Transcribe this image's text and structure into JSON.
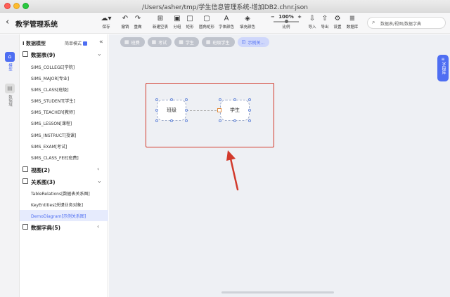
{
  "window": {
    "title": "/Users/asher/tmp/学生信息管理系统-增加DB2.chnr.json"
  },
  "header": {
    "back_glyph": "‹",
    "app_title": "教学管理系统",
    "toolbar": [
      {
        "id": "save",
        "label": "保存",
        "icon": "cloud-save-icon",
        "glyph": "☁▾"
      },
      {
        "id": "undo",
        "label": "撤销",
        "icon": "undo-icon",
        "glyph": "↶"
      },
      {
        "id": "redo",
        "label": "重做",
        "icon": "redo-icon",
        "glyph": "↷"
      },
      {
        "id": "new-table",
        "label": "新建空表",
        "icon": "new-table-icon",
        "glyph": "⊞"
      },
      {
        "id": "group",
        "label": "分组",
        "icon": "group-icon",
        "glyph": "▣"
      },
      {
        "id": "rect",
        "label": "矩形",
        "icon": "rect-icon",
        "glyph": "□"
      },
      {
        "id": "round-rect",
        "label": "圆角矩形",
        "icon": "round-rect-icon",
        "glyph": "▢"
      },
      {
        "id": "font-color",
        "label": "字体颜色",
        "icon": "font-color-icon",
        "glyph": "A"
      },
      {
        "id": "fill-color",
        "label": "填充颜色",
        "icon": "fill-color-icon",
        "glyph": "◈"
      },
      {
        "id": "import",
        "label": "导入",
        "icon": "import-icon",
        "glyph": "⇩"
      },
      {
        "id": "export",
        "label": "导出",
        "icon": "export-icon",
        "glyph": "⇧"
      },
      {
        "id": "settings",
        "label": "设置",
        "icon": "gear-icon",
        "glyph": "⚙"
      },
      {
        "id": "database",
        "label": "数据库",
        "icon": "database-icon",
        "glyph": "≣"
      }
    ],
    "zoom": {
      "minus": "−",
      "value": "100%",
      "plus": "+",
      "label": "比例",
      "level": 1.0
    },
    "search": {
      "icon_glyph": "⌕",
      "placeholder": "数据表/视图/数据字典"
    }
  },
  "rail": {
    "items": [
      {
        "label": "模型",
        "glyph": "⌂",
        "active": true
      },
      {
        "label": "数据域",
        "glyph": "▤",
        "active": false
      }
    ]
  },
  "sidebar": {
    "title": "I 数据模型",
    "mode_label": "简单模式",
    "collapse_glyph": "«",
    "groups": {
      "tables": {
        "label": "数据表(9)",
        "arrow": "⌄"
      },
      "views": {
        "label": "视图(2)",
        "arrow": "‹"
      },
      "relations": {
        "label": "关系图(3)",
        "arrow": "⌄"
      },
      "dicts": {
        "label": "数据字典(5)",
        "arrow": "‹"
      }
    },
    "tables": [
      "SIMS_COLLEGE[学院]",
      "SIMS_MAJOR[专业]",
      "SIMS_CLASS[班级]",
      "SIMS_STUDENT[学生]",
      "SIMS_TEACHER[教师]",
      "SIMS_LESSON[课程]",
      "SIMS_INSTRUCT[授课]",
      "SIMS_EXAM[考试]",
      "SIMS_CLASS_FEE[班费]"
    ],
    "relations": [
      "TableRelations[数据表关系图]",
      "KeyEntities[关键业务对象]",
      "DemoDiagram[示例关系图]"
    ]
  },
  "canvas": {
    "tabs": [
      {
        "label": "班费",
        "glyph": "▦",
        "active": false
      },
      {
        "label": "考试",
        "glyph": "▦",
        "active": false
      },
      {
        "label": "学生",
        "glyph": "▦",
        "active": false
      },
      {
        "label": "班级学生",
        "glyph": "▦",
        "active": false
      },
      {
        "label": "示例关...",
        "glyph": "⊡",
        "active": true
      }
    ],
    "right_tab": {
      "label": "字段库",
      "glyph": "≡"
    },
    "nodes": {
      "left": "班级",
      "right": "学生"
    },
    "colors": {
      "accent": "#4e6ef2",
      "highlight": "#d23a2c"
    }
  }
}
